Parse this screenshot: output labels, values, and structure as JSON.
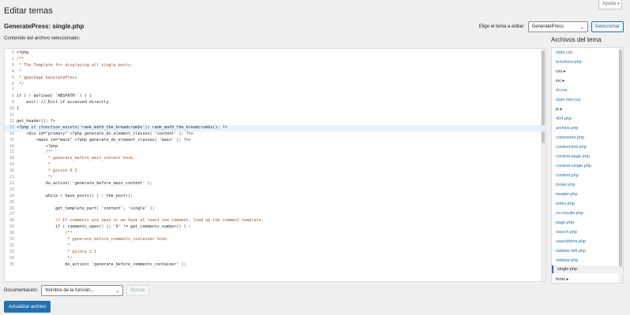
{
  "help_tab": "Ayuda",
  "page_title": "Editar temas",
  "file_title": "GeneratePress: single.php",
  "theme_picker": {
    "label": "Elige el tema a editar:",
    "selected": "GeneratePress",
    "button": "Seleccionar"
  },
  "content_label": "Contenido del archivo seleccionado:",
  "code_lines": [
    {
      "n": "1",
      "t": "<?php"
    },
    {
      "n": "2",
      "t": "/**"
    },
    {
      "n": "3",
      "t": " * The Template for displaying all single posts."
    },
    {
      "n": "4",
      "t": " *"
    },
    {
      "n": "5",
      "t": " * @package GeneratePress"
    },
    {
      "n": "6",
      "t": " */"
    },
    {
      "n": "7",
      "t": ""
    },
    {
      "n": "8",
      "t": "if ( ! defined( 'ABSPATH' ) ) {"
    },
    {
      "n": "9",
      "t": "    exit; // Exit if accessed directly."
    },
    {
      "n": "10",
      "t": "}"
    },
    {
      "n": "11",
      "t": ""
    },
    {
      "n": "12",
      "t": "get_header(); ?>"
    },
    {
      "n": "13",
      "t": "<?php if (function_exists('rank_math_the_breadcrumbs')) rank_math_the_breadcrumbs(); ?>"
    },
    {
      "n": "14",
      "t": "    <div id=\"primary\" <?php generate_do_element_classes( 'content' ); ?>>"
    },
    {
      "n": "15",
      "t": "        <main id=\"main\" <?php generate_do_element_classes( 'main' ); ?>>"
    },
    {
      "n": "16",
      "t": "            <?php"
    },
    {
      "n": "17",
      "t": "            /**"
    },
    {
      "n": "18",
      "t": "             * generate_before_main_content hook."
    },
    {
      "n": "19",
      "t": "             *"
    },
    {
      "n": "20",
      "t": "             * @since 0.1"
    },
    {
      "n": "21",
      "t": "             */"
    },
    {
      "n": "22",
      "t": "            do_action( 'generate_before_main_content' );"
    },
    {
      "n": "23",
      "t": ""
    },
    {
      "n": "24",
      "t": "            while ( have_posts() ) : the_post();"
    },
    {
      "n": "25",
      "t": ""
    },
    {
      "n": "26",
      "t": "                get_template_part( 'content', 'single' );"
    },
    {
      "n": "27",
      "t": ""
    },
    {
      "n": "28",
      "t": "                // If comments are open or we have at least one comment, load up the comment template."
    },
    {
      "n": "29",
      "t": "                if ( comments_open() || '0' != get_comments_number() ) :"
    },
    {
      "n": "30",
      "t": "                    /**"
    },
    {
      "n": "31",
      "t": "                     * generate_before_comments_container hook."
    },
    {
      "n": "32",
      "t": "                     *"
    },
    {
      "n": "33",
      "t": "                     * @since 2.1"
    },
    {
      "n": "34",
      "t": "                     */"
    },
    {
      "n": "35",
      "t": "                    do_action( 'generate_before_comments_container' );"
    }
  ],
  "files_heading": "Archivos del tema",
  "files": [
    {
      "name": "style.css"
    },
    {
      "name": "functions.php"
    },
    {
      "name": "css",
      "dir": true
    },
    {
      "name": "inc",
      "dir": true
    },
    {
      "name": "rtl.css"
    },
    {
      "name": "style.min.css"
    },
    {
      "name": "js",
      "dir": true
    },
    {
      "name": "404.php"
    },
    {
      "name": "archive.php"
    },
    {
      "name": "comments.php"
    },
    {
      "name": "content-link.php"
    },
    {
      "name": "content-page.php"
    },
    {
      "name": "content-single.php"
    },
    {
      "name": "content.php"
    },
    {
      "name": "footer.php"
    },
    {
      "name": "header.php"
    },
    {
      "name": "index.php"
    },
    {
      "name": "no-results.php"
    },
    {
      "name": "page.php"
    },
    {
      "name": "search.php"
    },
    {
      "name": "searchform.php"
    },
    {
      "name": "sidebar-left.php"
    },
    {
      "name": "sidebar.php"
    },
    {
      "name": "single.php",
      "active": true
    },
    {
      "name": "fonts",
      "dir": true
    }
  ],
  "docs": {
    "label": "Documentación:",
    "placeholder": "Nombre de la función...",
    "button": "Buscar"
  },
  "update_button": "Actualizar archivo"
}
